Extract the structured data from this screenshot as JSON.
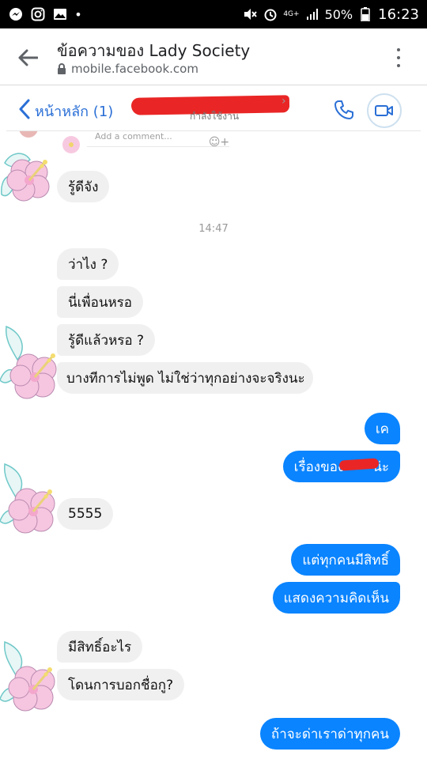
{
  "status_bar": {
    "battery": "50%",
    "time": "16:23",
    "network": "4G+"
  },
  "browser": {
    "title": "ข้อความของ Lady Society",
    "url": "mobile.facebook.com"
  },
  "messenger_header": {
    "back_label": "หน้าหลัก (1)",
    "status": "กำลังใช้งาน"
  },
  "comment_box": {
    "placeholder": "Add a comment..."
  },
  "messages": [
    {
      "id": "m1",
      "side": "in",
      "text": "รู้ดีจัง"
    },
    {
      "id": "ts1",
      "side": "time",
      "text": "14:47"
    },
    {
      "id": "m2",
      "side": "in",
      "text": "ว่าไง ?"
    },
    {
      "id": "m3",
      "side": "in",
      "text": "นี่เพื่อนหรอ"
    },
    {
      "id": "m4",
      "side": "in",
      "text": "รู้ดีแล้วหรอ ?"
    },
    {
      "id": "m5",
      "side": "in",
      "text": "บางทีการไม่พูด ไม่ใช่ว่าทุกอย่างจะจริงนะ"
    },
    {
      "id": "m6",
      "side": "out",
      "text": "เค"
    },
    {
      "id": "m7",
      "side": "out",
      "text_before": "เรื่องของ",
      "text_after": "น่ะ"
    },
    {
      "id": "m8",
      "side": "in",
      "text": "5555"
    },
    {
      "id": "m9",
      "side": "out",
      "text": "แต่ทุกคนมีสิทธิ์"
    },
    {
      "id": "m10",
      "side": "out",
      "text": "แสดงความคิดเห็น"
    },
    {
      "id": "m11",
      "side": "in",
      "text": "มีสิทธิ์อะไร"
    },
    {
      "id": "m12",
      "side": "in",
      "text": "โดนการบอกชื่อกู?"
    },
    {
      "id": "m13",
      "side": "out",
      "text": "ถ้าจะด่าเราด่าทุกคน"
    }
  ],
  "colors": {
    "outgoing_bubble": "#0a84ff",
    "incoming_bubble": "#f1f0f0",
    "accent": "#2a6fd6",
    "redaction": "#e92625"
  }
}
